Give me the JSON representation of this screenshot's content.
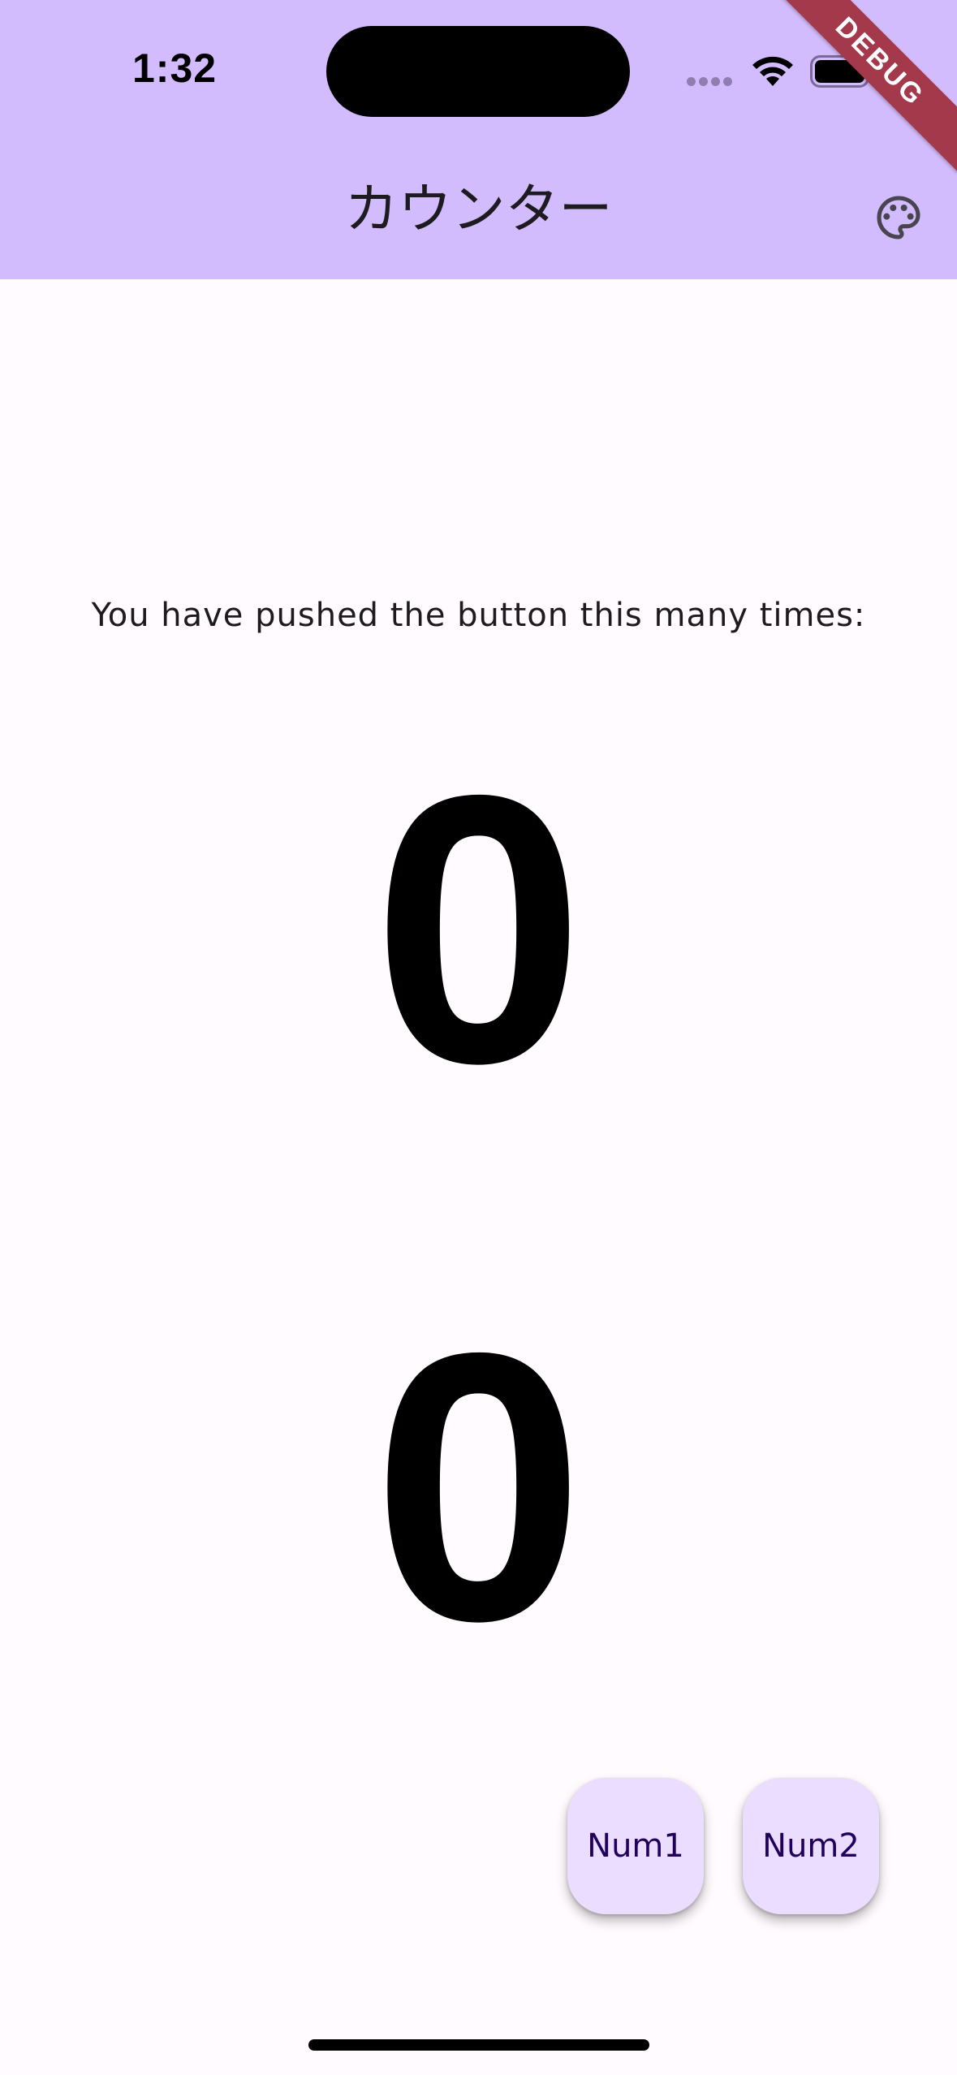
{
  "status_bar": {
    "time": "1:32",
    "wifi_icon": "wifi-icon",
    "battery_icon": "battery-icon",
    "cellular_icon": "cellular-dots-icon"
  },
  "debug_banner": {
    "label": "DEBUG"
  },
  "app_bar": {
    "title": "カウンター",
    "action_icon": "palette-icon"
  },
  "main": {
    "prompt": "You have pushed the button this many times:",
    "counters": [
      "0",
      "0"
    ]
  },
  "fabs": [
    {
      "label": "Num1"
    },
    {
      "label": "Num2"
    }
  ],
  "colors": {
    "app_bar_background": "#d3bcfd",
    "page_background": "#fffbfe",
    "fab_background": "#eaddff",
    "fab_text": "#21005d",
    "debug_banner": "#a3394b"
  }
}
